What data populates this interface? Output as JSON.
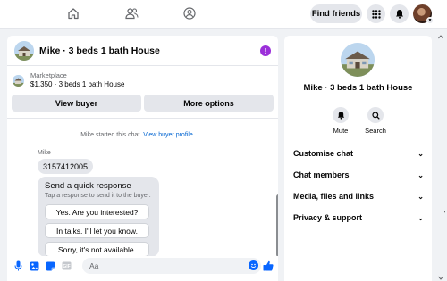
{
  "topbar": {
    "icons": [
      "home-icon",
      "friends-icon",
      "profile-circle-icon"
    ],
    "find_friends_label": "Find friends",
    "menu_icon": "grid-menu-icon",
    "notifications_icon": "bell-icon"
  },
  "chat": {
    "title": "Mike · 3 beds 1 bath House",
    "marketplace_label": "Marketplace",
    "listing_line": "$1,350 · 3 beds 1 bath House",
    "view_buyer_label": "View buyer",
    "more_options_label": "More options",
    "system_text": "Mike started this chat. ",
    "system_link": "View buyer profile",
    "sender_name": "Mike",
    "phone_message": "3157412005",
    "quick_title": "Send a quick response",
    "quick_subtitle": "Tap a response to send it to the buyer.",
    "quick_options": [
      "Yes. Are you interested?",
      "In talks. I'll let you know.",
      "Sorry, it's not available."
    ]
  },
  "composer": {
    "placeholder": "Aa",
    "icons": [
      "microphone-icon",
      "photo-icon",
      "sticker-icon",
      "gif-icon",
      "emoji-icon",
      "like-icon"
    ]
  },
  "info_panel": {
    "title": "Mike · 3 beds 1 bath House",
    "mute_label": "Mute",
    "search_label": "Search",
    "menu": [
      "Customise chat",
      "Chat members",
      "Media, files and links",
      "Privacy & support"
    ]
  },
  "colors": {
    "accent": "#0866ff",
    "info_purple": "#9b30d9",
    "link": "#0064d1",
    "bubble": "#e4e6eb"
  }
}
